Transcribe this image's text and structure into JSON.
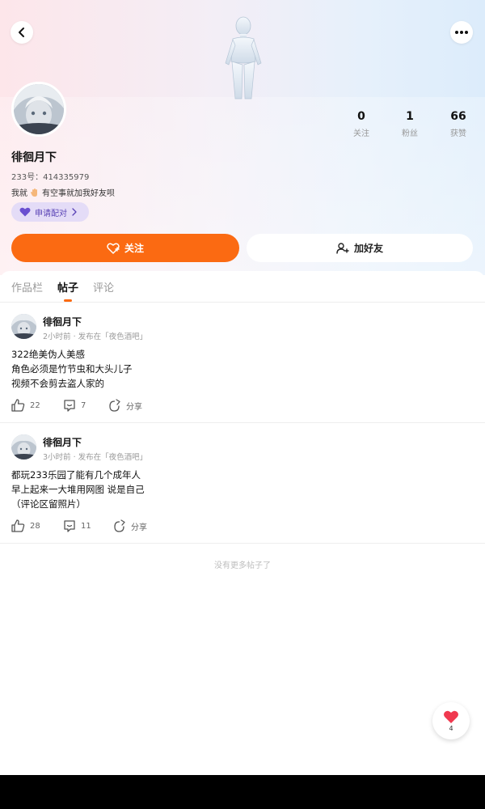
{
  "profile": {
    "name": "徘徊月下",
    "uid": "233号：414335979",
    "bio_before": "我就",
    "bio_after": "有空事就加我好友呗",
    "match_label": "申请配对",
    "stats": [
      {
        "value": "0",
        "label": "关注"
      },
      {
        "value": "1",
        "label": "粉丝"
      },
      {
        "value": "66",
        "label": "获赞"
      }
    ]
  },
  "actions": {
    "follow_label": "关注",
    "add_friend_label": "加好友"
  },
  "tabs": [
    {
      "label": "作品栏",
      "active": false
    },
    {
      "label": "帖子",
      "active": true
    },
    {
      "label": "评论",
      "active": false
    }
  ],
  "posts": [
    {
      "author": "徘徊月下",
      "meta": "2小时前 · 发布在「夜色酒吧」",
      "lines": [
        "322绝美伪人美感",
        "角色必须是竹节虫和大头儿子",
        "视频不会剪去盗人家的"
      ],
      "likes": "22",
      "comments": "7",
      "share_label": "分享"
    },
    {
      "author": "徘徊月下",
      "meta": "3小时前 · 发布在「夜色酒吧」",
      "lines": [
        "都玩233乐园了能有几个成年人",
        "早上起来一大堆用网图 说是自己",
        "（评论区留照片）"
      ],
      "likes": "28",
      "comments": "11",
      "share_label": "分享"
    }
  ],
  "footer": {
    "no_more": "没有更多帖子了"
  },
  "float": {
    "count": "4"
  },
  "colors": {
    "accent": "#fb6a12",
    "match_text": "#5a43b6"
  },
  "icons": [
    "back-icon",
    "more-icon",
    "heart-icon",
    "chevron-right-icon",
    "follow-heart-icon",
    "add-user-icon",
    "like-icon",
    "comment-icon",
    "share-icon"
  ]
}
